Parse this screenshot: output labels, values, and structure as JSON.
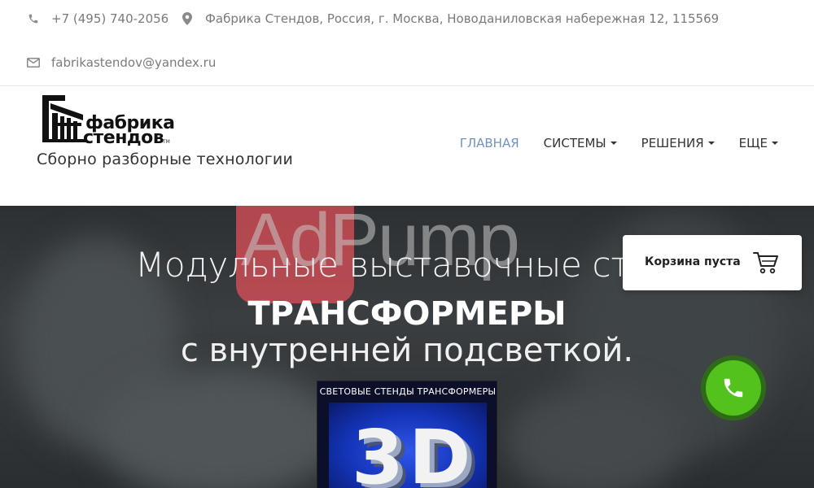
{
  "topbar": {
    "phone": "+7 (495) 740-2056",
    "address": "Фабрика Стендов, Россия, г. Москва, Новоданиловская набережная 12, 115569",
    "email": "fabrikastendov@yandex.ru"
  },
  "header": {
    "logo_line1": "фабрика",
    "logo_line2": "стендов",
    "logo_tm": "TM",
    "tagline": "Сборно разборные технологии"
  },
  "nav": {
    "items": [
      {
        "label": "ГЛАВНАЯ",
        "active": true
      },
      {
        "label": "СИСТЕМЫ",
        "dropdown": true
      },
      {
        "label": "РЕШЕНИЯ",
        "dropdown": true
      },
      {
        "label": "ЕЩЕ",
        "dropdown": true
      }
    ]
  },
  "hero": {
    "line1": "Модульные выставочные стенды",
    "line2": "ТРАНСФОРМЕРЫ",
    "line3": "с внутренней подсветкой.",
    "watermark": "AdPump",
    "poster_title": "СВЕТОВЫЕ СТЕНДЫ ТРАНСФОРМЕРЫ",
    "poster_big": "3D"
  },
  "cart": {
    "label": "Корзина пуста"
  },
  "colors": {
    "nav_active": "#6f93c0",
    "call_green": "#53c21c",
    "watermark_red": "#e6505a"
  }
}
